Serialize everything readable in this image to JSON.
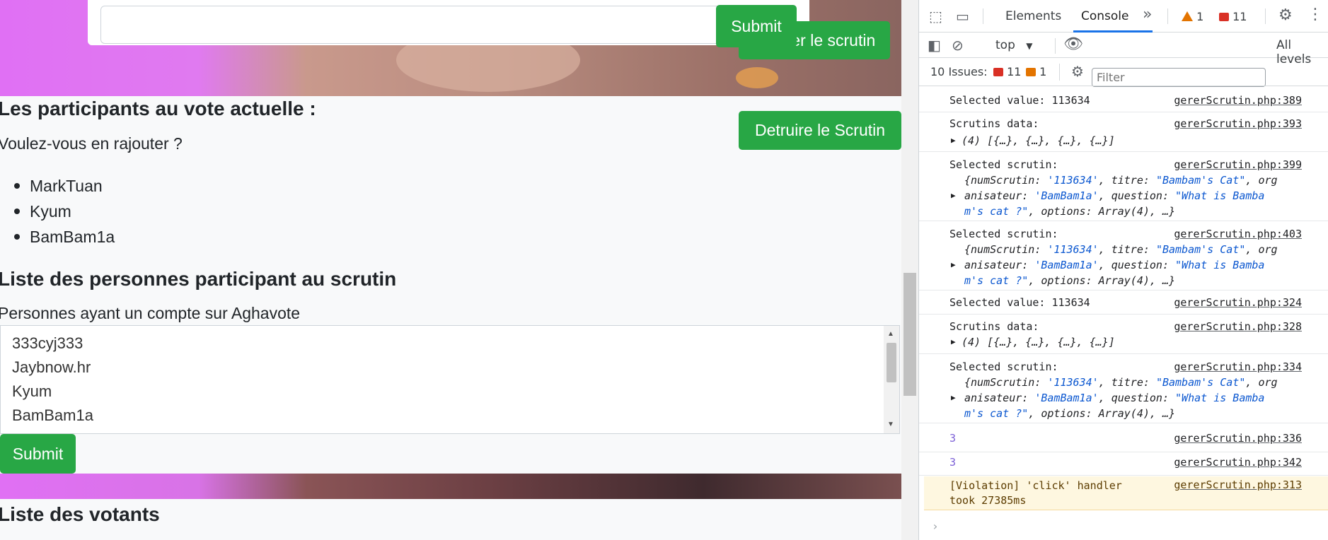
{
  "page": {
    "top_form": {
      "submit_label": "Submit",
      "fermer_label": "Fermer le scrutin"
    },
    "detruire_label": "Detruire le Scrutin",
    "participants_heading": "Les participants au vote actuelle :",
    "add_question": "Voulez-vous en rajouter ?",
    "participants": [
      "MarkTuan",
      "Kyum",
      "BamBam1a"
    ],
    "list_heading": "Liste des personnes participant au scrutin",
    "accounts_label": "Personnes ayant un compte sur Aghavote",
    "accounts_options": [
      "333cyj333",
      "Jaybnow.hr",
      "Kyum",
      "BamBam1a"
    ],
    "submit_label": "Submit",
    "voters_heading": "Liste des votants"
  },
  "devtools": {
    "tabs": [
      "Elements",
      "Console"
    ],
    "active_tab": "Console",
    "warning_count": "1",
    "error_count": "11",
    "context": "top",
    "filter_placeholder": "Filter",
    "levels": "All levels",
    "issues_label": "10 Issues:",
    "issues_errors": "11",
    "issues_warnings": "1",
    "logs": {
      "l1": {
        "msg": "Selected value: 113634",
        "src": "gererScrutin.php:389"
      },
      "l2": {
        "msg": "Scrutins data:",
        "detail": "(4) [{…}, {…}, {…}, {…}]",
        "src": "gererScrutin.php:393"
      },
      "l3": {
        "msg": "Selected scrutin:",
        "src": "gererScrutin.php:399"
      },
      "l4": {
        "msg": "Selected scrutin:",
        "src": "gererScrutin.php:403"
      },
      "l5": {
        "msg": "Selected value: 113634",
        "src": "gererScrutin.php:324"
      },
      "l6": {
        "msg": "Scrutins data:",
        "detail": "(4) [{…}, {…}, {…}, {…}]",
        "src": "gererScrutin.php:328"
      },
      "l7": {
        "msg": "Selected scrutin:",
        "src": "gererScrutin.php:334"
      },
      "l8": {
        "msg": "3",
        "src": "gererScrutin.php:336"
      },
      "l9": {
        "msg": "3",
        "src": "gererScrutin.php:342"
      },
      "l10": {
        "msg": "[Violation] 'click' handler\ntook 27385ms",
        "src": "gererScrutin.php:313"
      }
    },
    "scrutin_obj": {
      "k1": "numScrutin",
      "v1": "'113634'",
      "k2": "titre",
      "v2": "\"Bambam's Cat\"",
      "k3a": "org",
      "k3b": "anisateur",
      "v3": "'BamBam1a'",
      "k4": "question",
      "v4a": "\"What is Bamba",
      "v4b": "m's cat ?\"",
      "k5": "options",
      "v5": "Array(4)"
    },
    "colors": {
      "accent": "#1a73e8",
      "error": "#d93025",
      "warning": "#e37400",
      "button_green": "#28a745"
    }
  }
}
